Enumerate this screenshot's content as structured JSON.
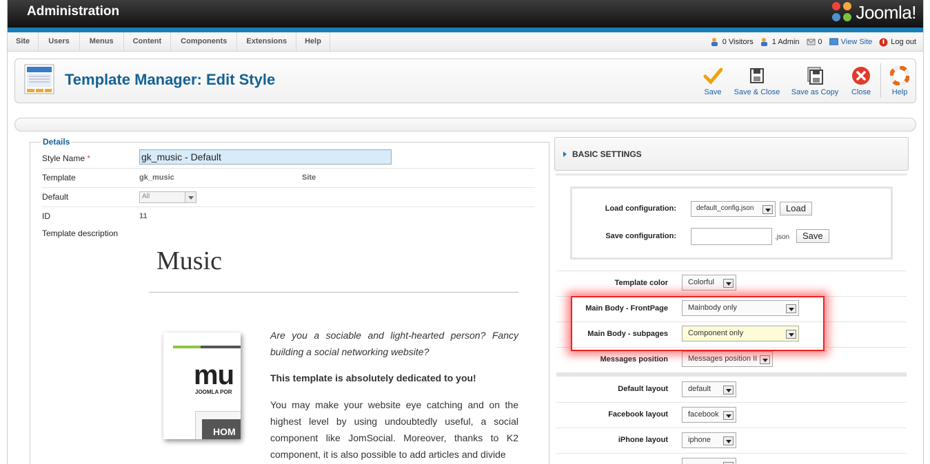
{
  "header": {
    "title": "Administration",
    "logo_text": "Joomla!"
  },
  "menu": [
    "Site",
    "Users",
    "Menus",
    "Content",
    "Components",
    "Extensions",
    "Help"
  ],
  "status": {
    "visitors": "0 Visitors",
    "admin": "1 Admin",
    "messages": "0",
    "view_site": "View Site",
    "logout": "Log out"
  },
  "toolbar": {
    "title": "Template Manager: Edit Style",
    "save": "Save",
    "save_close": "Save & Close",
    "save_copy": "Save as Copy",
    "close": "Close",
    "help": "Help"
  },
  "details": {
    "legend": "Details",
    "style_name_label": "Style Name",
    "required_mark": "*",
    "style_name_value": "gk_music - Default",
    "template_label": "Template",
    "template_value": "gk_music",
    "template_client": "Site",
    "default_label": "Default",
    "default_value": "All",
    "id_label": "ID",
    "id_value": "11",
    "desc_label": "Template description"
  },
  "description": {
    "heading": "Music",
    "preview_text": "mu",
    "preview_sub": "JOOMLA POR",
    "preview_btn": "HOM",
    "p1": "Are you a sociable and light-hearted person? Fancy building a social networking website?",
    "p2": "This template is absolutely dedicated to you!",
    "p3": "You may make your website eye catching and on the highest level by using undoubtedly useful, a social component like JomSocial. Moreover, thanks to K2 component, it is also possible to add articles and divide"
  },
  "basic_settings": {
    "header": "BASIC SETTINGS",
    "load_config_label": "Load configuration:",
    "load_config_value": "default_config.json",
    "load_button": "Load",
    "save_config_label": "Save configuration:",
    "save_config_suffix": ".json",
    "save_button": "Save",
    "template_color_label": "Template color",
    "template_color_value": "Colorful",
    "main_front_label": "Main Body - FrontPage",
    "main_front_value": "Mainbody only",
    "main_sub_label": "Main Body - subpages",
    "main_sub_value": "Component only",
    "messages_label": "Messages position",
    "messages_value": "Messages position II",
    "default_layout_label": "Default layout",
    "default_layout_value": "default",
    "facebook_layout_label": "Facebook layout",
    "facebook_layout_value": "facebook",
    "iphone_layout_label": "iPhone layout",
    "iphone_layout_value": "iphone"
  },
  "colors": {
    "accent": "#1a7db5",
    "title": "#146295",
    "highlight": "#ee2222"
  }
}
